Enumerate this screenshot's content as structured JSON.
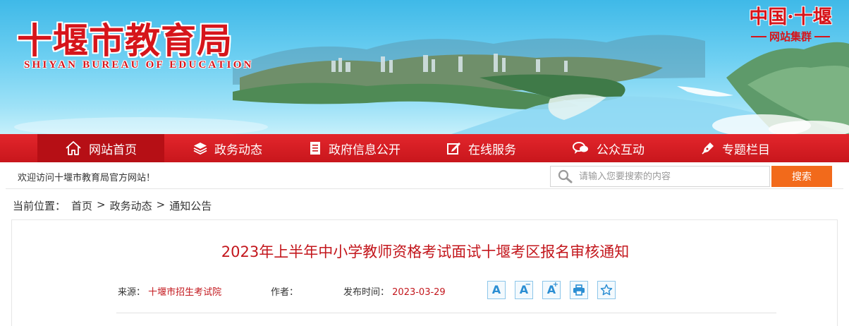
{
  "header": {
    "title": "十堰市教育局",
    "subtitle": "SHIYAN BUREAU OF EDUCATION",
    "group_logo_line1": "中国·十堰",
    "group_logo_line2": "网站集群"
  },
  "nav": {
    "items": [
      {
        "label": "网站首页",
        "icon": "home-icon",
        "active": true
      },
      {
        "label": "政务动态",
        "icon": "layers-icon",
        "active": false
      },
      {
        "label": "政府信息公开",
        "icon": "document-icon",
        "active": false
      },
      {
        "label": "在线服务",
        "icon": "edit-icon",
        "active": false
      },
      {
        "label": "公众互动",
        "icon": "chat-icon",
        "active": false
      },
      {
        "label": "专题栏目",
        "icon": "pen-icon",
        "active": false
      }
    ]
  },
  "welcome": {
    "text": "欢迎访问十堰市教育局官方网站！",
    "search_placeholder": "请输入您要搜索的内容",
    "search_button": "搜索"
  },
  "breadcrumb": {
    "label": "当前位置：",
    "items": [
      "首页",
      "政务动态",
      "通知公告"
    ],
    "separator": ">"
  },
  "article": {
    "title": "2023年上半年中小学教师资格考试面试十堰考区报名审核通知",
    "source_label": "来源：",
    "source": "十堰市招生考试院",
    "author_label": "作者：",
    "author": "",
    "date_label": "发布时间：",
    "date": "2023-03-29",
    "tools": [
      {
        "name": "font-default-icon",
        "glyph": "A",
        "sup": ""
      },
      {
        "name": "font-decrease-icon",
        "glyph": "A",
        "sup": "−"
      },
      {
        "name": "font-increase-icon",
        "glyph": "A",
        "sup": "+"
      },
      {
        "name": "print-icon",
        "glyph": "",
        "sup": ""
      },
      {
        "name": "favorite-star-icon",
        "glyph": "",
        "sup": ""
      }
    ]
  },
  "colors": {
    "brand_red": "#d6151b",
    "nav_red": "#e3262c",
    "nav_active": "#b60f15",
    "search_orange": "#f26a1b",
    "tool_blue": "#2b8ed3"
  }
}
